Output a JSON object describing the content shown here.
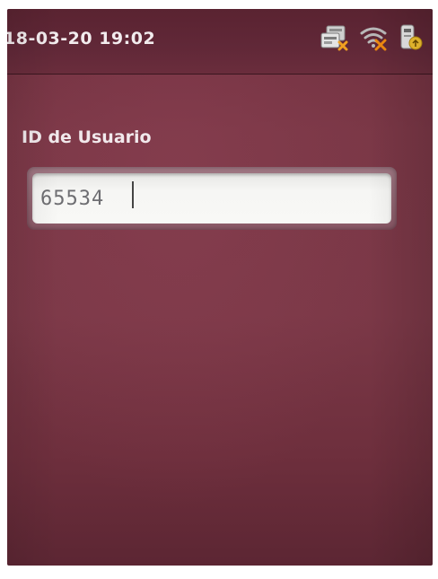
{
  "status_bar": {
    "datetime": "18-03-20 19:02",
    "icons": [
      "network-disconnected-icon",
      "wifi-disconnected-icon",
      "usb-device-icon"
    ]
  },
  "form": {
    "label": "ID de Usuario",
    "user_id_value": "65534"
  },
  "colors": {
    "background": "#7a3746",
    "status_bar": "#5e2635",
    "label_text": "#f1e9ec",
    "input_background": "#f6f6f4"
  }
}
